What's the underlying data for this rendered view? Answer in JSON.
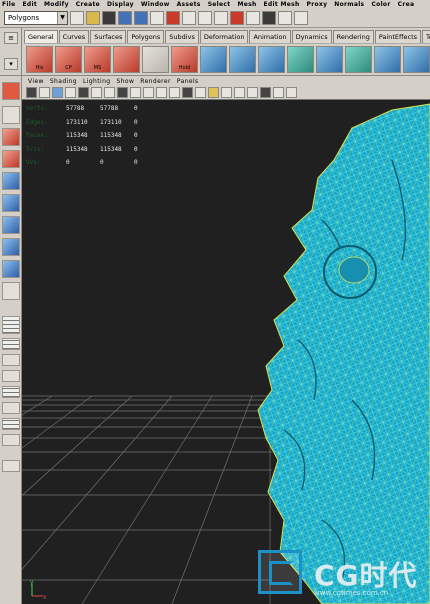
{
  "menubar": [
    "File",
    "Edit",
    "Modify",
    "Create",
    "Display",
    "Window",
    "Assets",
    "Select",
    "Mesh",
    "Edit Mesh",
    "Proxy",
    "Normals",
    "Color",
    "Crea"
  ],
  "status_line": {
    "mode_value": "Polygons"
  },
  "shelf": {
    "tabs": [
      "General",
      "Curves",
      "Surfaces",
      "Polygons",
      "Subdivs",
      "Deformation",
      "Animation",
      "Dynamics",
      "Rendering",
      "PaintEffects",
      "Toon"
    ],
    "active_tab": 0,
    "icon_labels": [
      "His",
      "CP",
      "MS",
      "",
      "",
      "Hold",
      "",
      "",
      "",
      "",
      "",
      "",
      "",
      ""
    ]
  },
  "panel_menu": [
    "View",
    "Shading",
    "Lighting",
    "Show",
    "Renderer",
    "Panels"
  ],
  "hud": {
    "rows": [
      {
        "label": "Verts:",
        "a": "57788",
        "b": "57788",
        "c": "0"
      },
      {
        "label": "Edges:",
        "a": "173110",
        "b": "173110",
        "c": "0"
      },
      {
        "label": "Faces:",
        "a": "115348",
        "b": "115348",
        "c": "0"
      },
      {
        "label": "Tris:",
        "a": "115348",
        "b": "115348",
        "c": "0"
      },
      {
        "label": "UVs:",
        "a": "0",
        "b": "0",
        "c": "0"
      }
    ]
  },
  "colors": {
    "viewport_bg": "#202020",
    "wire_cyan": "#2fc8e0",
    "wire_yellow": "#d8e04a",
    "ui_gray": "#d4d0c8",
    "watermark_blue": "#1e90c8"
  },
  "watermark": {
    "text": "CG时代",
    "url": "www.cgtimes.com.cn"
  }
}
